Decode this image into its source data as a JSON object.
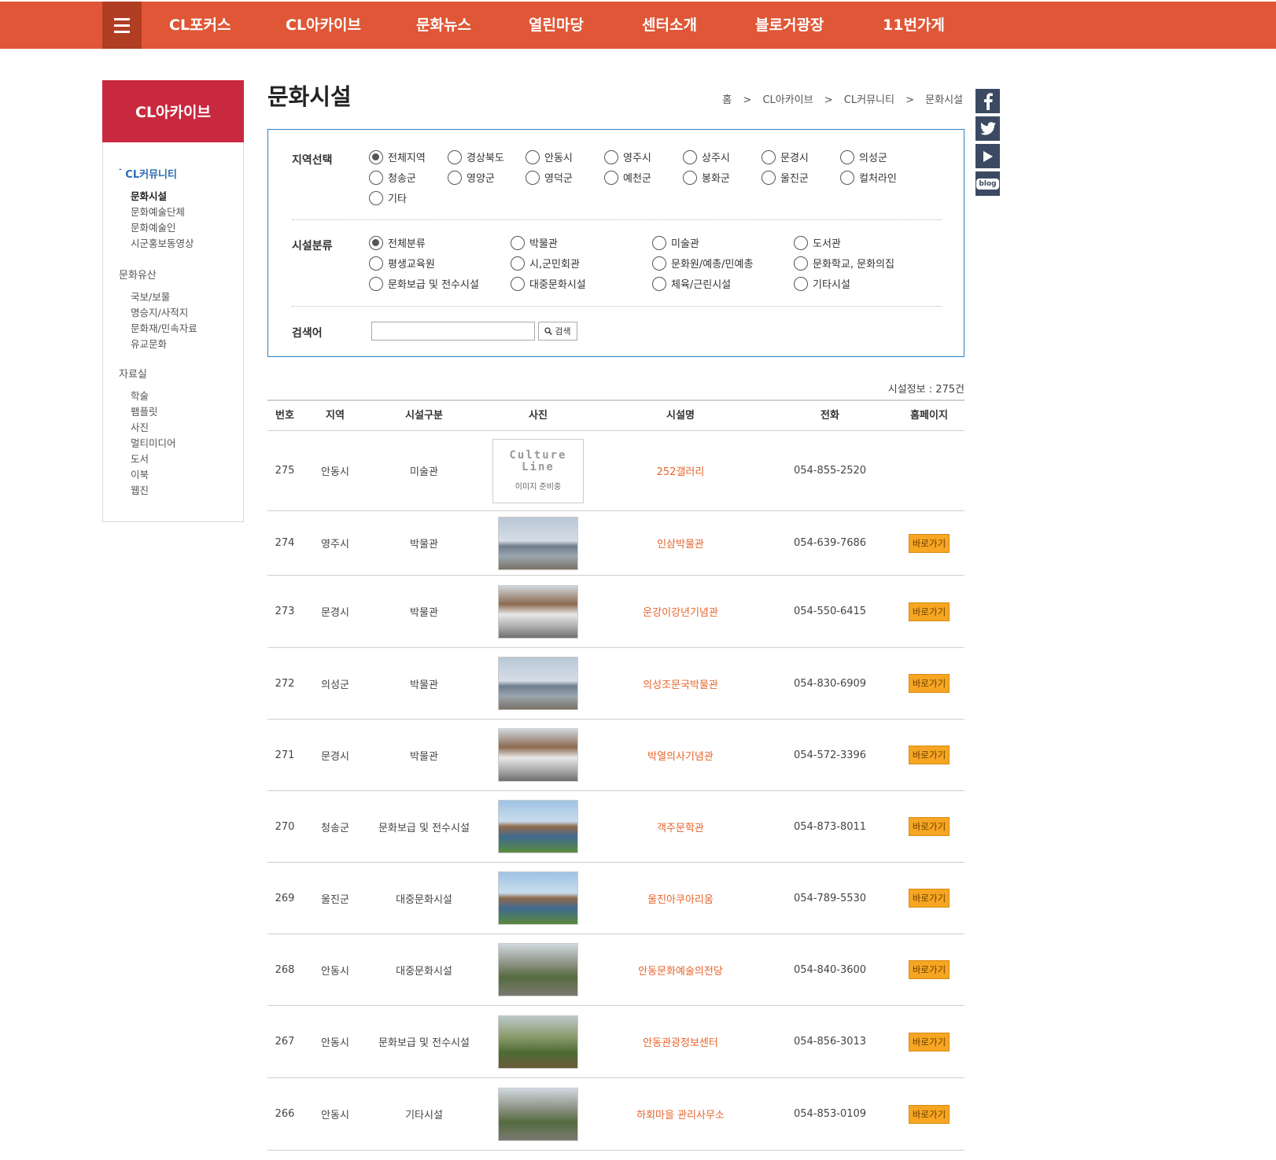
{
  "nav": {
    "items": [
      "CL포커스",
      "CL아카이브",
      "문화뉴스",
      "열린마당",
      "센터소개",
      "블로거광장",
      "11번가게"
    ]
  },
  "sidebar": {
    "title": "CL아카이브",
    "groups": [
      {
        "label": "CL커뮤니티",
        "items": [
          "문화시설",
          "문화예술단체",
          "문화예술인",
          "시군홍보동영상"
        ]
      },
      {
        "label": "문화유산",
        "items": [
          "국보/보물",
          "명승지/사적지",
          "문화재/민속자료",
          "유교문화"
        ]
      },
      {
        "label": "자료실",
        "items": [
          "학술",
          "팸플릿",
          "사진",
          "멀티미디어",
          "도서",
          "이북",
          "웹진"
        ]
      }
    ]
  },
  "page": {
    "title": "문화시설",
    "breadcrumb": [
      "홈",
      ">",
      "CL아카이브",
      ">",
      "CL커뮤니티",
      ">",
      "문화시설"
    ]
  },
  "social": [
    "facebook-icon",
    "twitter-icon",
    "youtube-icon",
    "blog-icon"
  ],
  "social_blog_text": "blog",
  "filter": {
    "region_label": "지역선택",
    "regions": [
      "전체지역",
      "경상북도",
      "안동시",
      "영주시",
      "상주시",
      "문경시",
      "의성군",
      "청송군",
      "영양군",
      "영덕군",
      "예천군",
      "봉화군",
      "울진군",
      "컬처라인",
      "기타"
    ],
    "region_selected": "전체지역",
    "category_label": "시설분류",
    "categories": [
      "전체분류",
      "박물관",
      "미술관",
      "도서관",
      "평생교육원",
      "시,군민회관",
      "문화원/예총/민예총",
      "문화학교, 문화의집",
      "문화보급 및 전수시설",
      "대중문화시설",
      "체육/근린시설",
      "기타시설"
    ],
    "category_selected": "전체분류",
    "search_label": "검색어",
    "search_value": "",
    "search_button": "검색"
  },
  "count_text": "시설정보 : 275건",
  "table": {
    "headers": [
      "번호",
      "지역",
      "시설구분",
      "사진",
      "시설명",
      "전화",
      "홈페이지"
    ],
    "placeholder_logo": [
      "Culture",
      "Line"
    ],
    "placeholder_text": "이미지 준비중",
    "go_label": "바로가기",
    "rows": [
      {
        "no": "275",
        "region": "안동시",
        "type": "미술관",
        "name": "252갤러리",
        "phone": "054-855-2520",
        "photo": "placeholder",
        "link": false
      },
      {
        "no": "274",
        "region": "영주시",
        "type": "박물관",
        "name": "인삼박물관",
        "phone": "054-639-7686",
        "photo": "museum-photo",
        "link": true
      },
      {
        "no": "273",
        "region": "문경시",
        "type": "박물관",
        "name": "운강이강년기념관",
        "phone": "054-550-6415",
        "photo": "memorial-photo",
        "link": true
      },
      {
        "no": "272",
        "region": "의성군",
        "type": "박물관",
        "name": "의성조문국박물관",
        "phone": "054-830-6909",
        "photo": "museum-photo",
        "link": true
      },
      {
        "no": "271",
        "region": "문경시",
        "type": "박물관",
        "name": "박열의사기념관",
        "phone": "054-572-3396",
        "photo": "memorial-photo",
        "link": true
      },
      {
        "no": "270",
        "region": "청송군",
        "type": "문화보급 및 전수시설",
        "name": "객주문학관",
        "phone": "054-873-8011",
        "photo": "building-photo",
        "link": true
      },
      {
        "no": "269",
        "region": "울진군",
        "type": "대중문화시설",
        "name": "울진아쿠아리움",
        "phone": "054-789-5530",
        "photo": "building-photo",
        "link": true
      },
      {
        "no": "268",
        "region": "안동시",
        "type": "대중문화시설",
        "name": "안동문화예술의전당",
        "phone": "054-840-3600",
        "photo": "aerial-photo",
        "link": true
      },
      {
        "no": "267",
        "region": "안동시",
        "type": "문화보급 및 전수시설",
        "name": "안동관광정보센터",
        "phone": "054-856-3013",
        "photo": "village-photo",
        "link": true
      },
      {
        "no": "266",
        "region": "안동시",
        "type": "기타시설",
        "name": "하회마을 관리사무소",
        "phone": "054-853-0109",
        "photo": "aerial-photo",
        "link": true
      }
    ]
  }
}
